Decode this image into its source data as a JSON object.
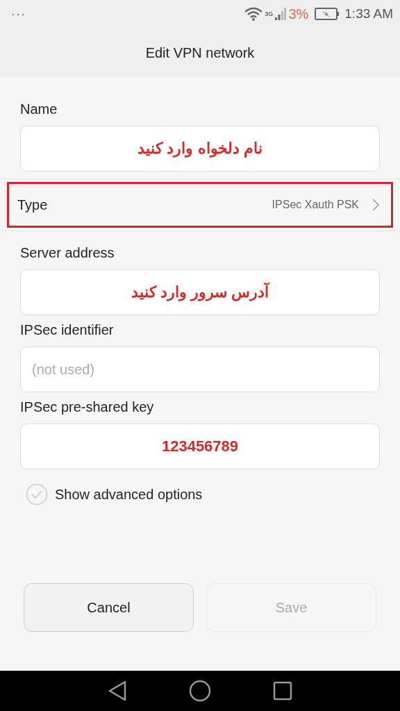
{
  "status_bar": {
    "menu": "···",
    "network": "3G",
    "battery": "3%",
    "time": "1:33 AM"
  },
  "title": "Edit VPN network",
  "fields": [
    {
      "kind": "input",
      "label": "Name",
      "value": "نام دلخواه وارد کنید"
    },
    {
      "kind": "select",
      "label": "Type",
      "value": "IPSec Xauth PSK",
      "highlighted": true
    },
    {
      "kind": "input",
      "label": "Server address",
      "value": "آدرس سرور وارد کنید"
    },
    {
      "kind": "input",
      "label": "IPSec identifier",
      "placeholder": "(not used)"
    },
    {
      "kind": "input",
      "label": "IPSec pre-shared key",
      "value": "123456789"
    }
  ],
  "advanced": {
    "label": "Show advanced options",
    "checked": false
  },
  "buttons": [
    {
      "label": "Cancel",
      "disabled": false
    },
    {
      "label": "Save",
      "disabled": true
    }
  ]
}
